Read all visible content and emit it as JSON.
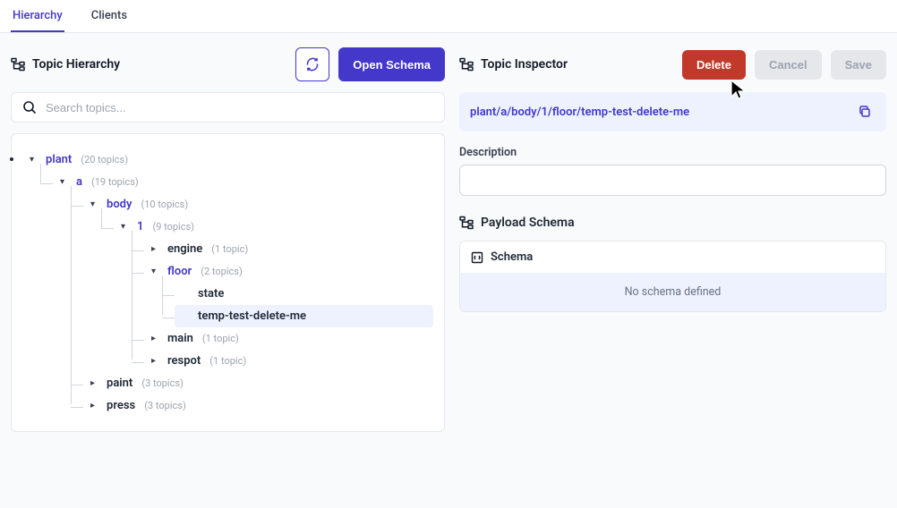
{
  "tabs": {
    "hierarchy": "Hierarchy",
    "clients": "Clients",
    "active": "hierarchy"
  },
  "left_panel": {
    "title": "Topic Hierarchy",
    "open_schema": "Open Schema",
    "search_placeholder": "Search topics..."
  },
  "tree": {
    "plant": {
      "label": "plant",
      "count": "(20 topics)"
    },
    "a": {
      "label": "a",
      "count": "(19 topics)"
    },
    "body": {
      "label": "body",
      "count": "(10 topics)"
    },
    "one": {
      "label": "1",
      "count": "(9 topics)"
    },
    "engine": {
      "label": "engine",
      "count": "(1 topic)"
    },
    "floor": {
      "label": "floor",
      "count": "(2 topics)"
    },
    "state": {
      "label": "state"
    },
    "temp": {
      "label": "temp-test-delete-me"
    },
    "main": {
      "label": "main",
      "count": "(1 topic)"
    },
    "respot": {
      "label": "respot",
      "count": "(1 topic)"
    },
    "paint": {
      "label": "paint",
      "count": "(3 topics)"
    },
    "press": {
      "label": "press",
      "count": "(3 topics)"
    }
  },
  "inspector": {
    "title": "Topic Inspector",
    "delete": "Delete",
    "cancel": "Cancel",
    "save": "Save",
    "topic_path": "plant/a/body/1/floor/temp-test-delete-me",
    "description_label": "Description",
    "description_value": "",
    "payload_title": "Payload Schema",
    "schema_title": "Schema",
    "schema_empty": "No schema defined"
  }
}
